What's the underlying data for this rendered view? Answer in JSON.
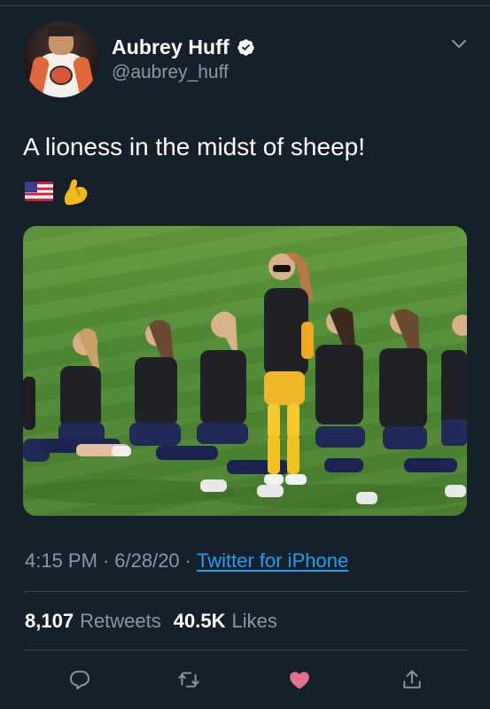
{
  "tweet": {
    "author": {
      "display_name": "Aubrey Huff",
      "handle": "@aubrey_huff",
      "verified": true
    },
    "text": "A lioness in the midst of sheep!",
    "emojis": [
      "us-flag-icon",
      "flexed-biceps-icon"
    ],
    "timestamp_time": "4:15 PM",
    "timestamp_date": "6/28/20",
    "separator": "·",
    "source": "Twitter for iPhone",
    "stats": {
      "retweets_count": "8,107",
      "retweets_label": "Retweets",
      "likes_count": "40.5K",
      "likes_label": "Likes"
    },
    "actions": [
      "reply-icon",
      "retweet-icon",
      "like-icon",
      "share-icon"
    ]
  },
  "colors": {
    "background": "#15202b",
    "text_primary": "#ffffff",
    "text_secondary": "#8899a6",
    "link": "#1da1f2",
    "divider": "#38444d",
    "like_active": "#e0245e"
  }
}
